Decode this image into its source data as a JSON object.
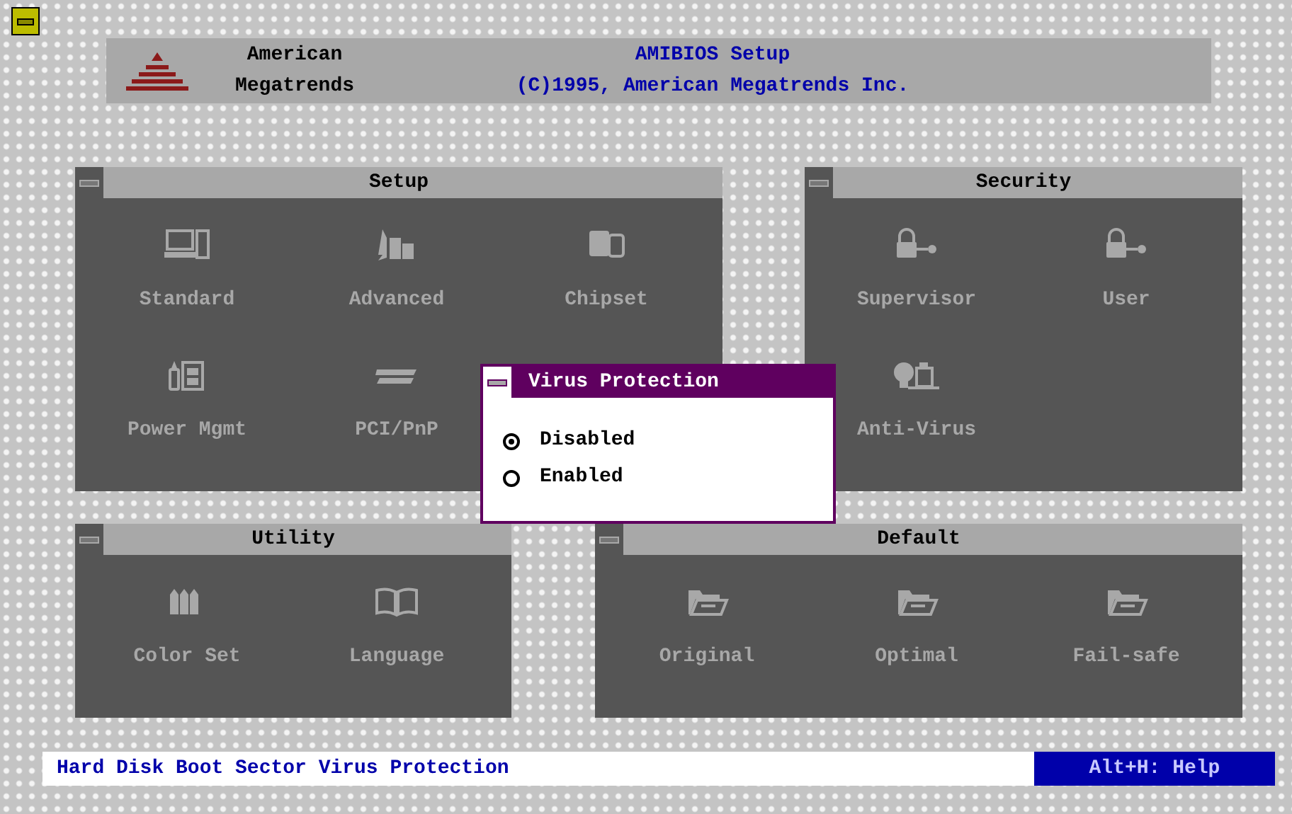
{
  "header": {
    "company_line_1": "American",
    "company_line_2": "Megatrends",
    "title": "AMIBIOS Setup",
    "copyright": "(C)1995, American Megatrends Inc."
  },
  "panels": [
    {
      "title": "Setup",
      "items": [
        "Standard",
        "Advanced",
        "Chipset",
        "Power Mgmt",
        "PCI/PnP"
      ]
    },
    {
      "title": "Security",
      "items": [
        "Supervisor",
        "User",
        "Anti-Virus"
      ]
    },
    {
      "title": "Utility",
      "items": [
        "Color Set",
        "Language"
      ]
    },
    {
      "title": "Default",
      "items": [
        "Original",
        "Optimal",
        "Fail-safe"
      ]
    }
  ],
  "dialog": {
    "title": "Virus Protection",
    "options": [
      {
        "label": "Disabled",
        "selected": true
      },
      {
        "label": "Enabled",
        "selected": false
      }
    ]
  },
  "status_bar": {
    "message": "Hard Disk Boot Sector Virus Protection",
    "help": "Alt+H: Help"
  }
}
